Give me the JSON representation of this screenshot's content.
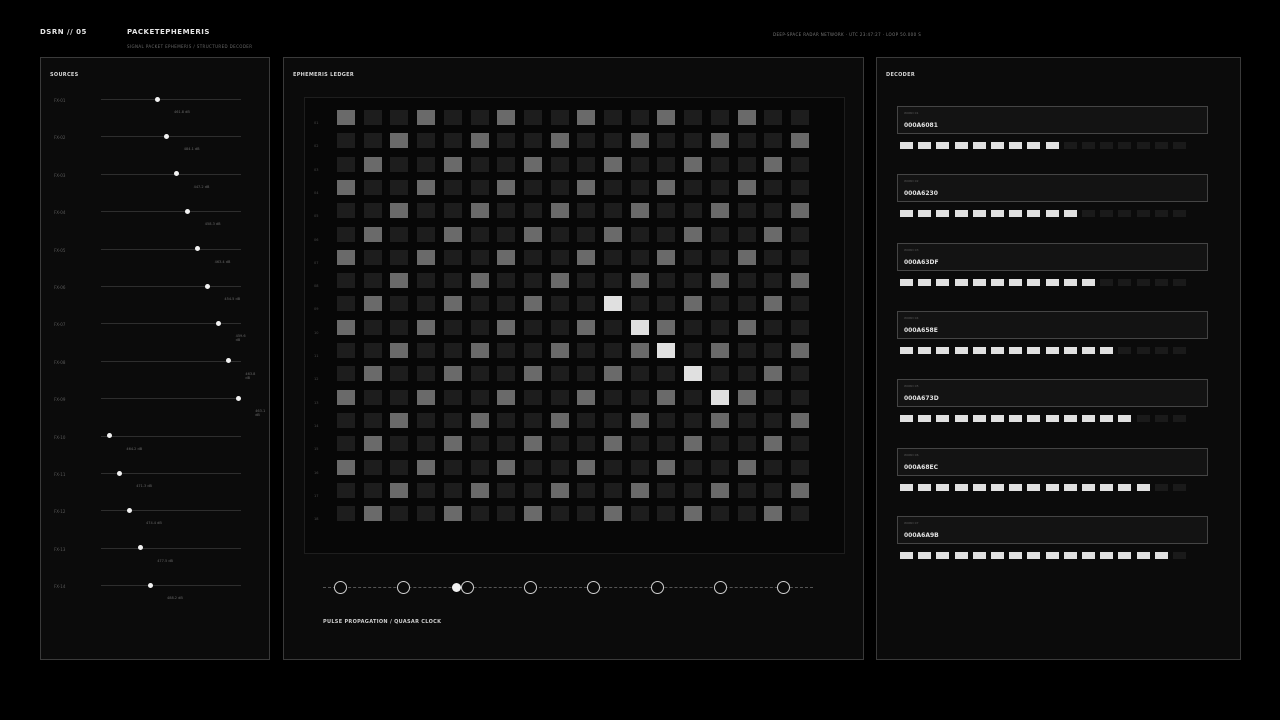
{
  "header": {
    "code": "DSRN // 05",
    "title": "PACKETEPHEMERIS",
    "subtitle": "SIGNAL PACKET EPHEMERIS / STRUCTURED DECODER",
    "status": "DEEP-SPACE RADAR NETWORK · UTC 23:47:27 · LOOP 50.000 S"
  },
  "sources": {
    "title": "SOURCES",
    "items": [
      {
        "label": "FX-01",
        "level": 0.4,
        "value": "461.8 dB"
      },
      {
        "label": "FX-02",
        "level": 0.47,
        "value": "484.1 dB"
      },
      {
        "label": "FX-03",
        "level": 0.54,
        "value": "447.2 dB"
      },
      {
        "label": "FX-04",
        "level": 0.62,
        "value": "458.3 dB"
      },
      {
        "label": "FX-05",
        "level": 0.69,
        "value": "463.4 dB"
      },
      {
        "label": "FX-06",
        "level": 0.76,
        "value": "454.5 dB"
      },
      {
        "label": "FX-07",
        "level": 0.84,
        "value": "459.6 dB"
      },
      {
        "label": "FX-08",
        "level": 0.91,
        "value": "463.8 dB"
      },
      {
        "label": "FX-09",
        "level": 0.98,
        "value": "463.1 dB"
      },
      {
        "label": "FX-10",
        "level": 0.06,
        "value": "464.2 dB"
      },
      {
        "label": "FX-11",
        "level": 0.13,
        "value": "471.3 dB"
      },
      {
        "label": "FX-12",
        "level": 0.2,
        "value": "474.4 dB"
      },
      {
        "label": "FX-13",
        "level": 0.28,
        "value": "477.5 dB"
      },
      {
        "label": "FX-14",
        "level": 0.35,
        "value": "488.2 dB"
      }
    ]
  },
  "ledger": {
    "title": "EPHEMERIS LEDGER",
    "row_labels": [
      "01",
      "02",
      "03",
      "04",
      "05",
      "06",
      "07",
      "08",
      "09",
      "10",
      "11",
      "12",
      "13",
      "14",
      "15",
      "16",
      "17",
      "18"
    ],
    "highlights": [
      [
        8,
        10
      ],
      [
        9,
        11
      ],
      [
        10,
        12
      ],
      [
        11,
        13
      ],
      [
        12,
        14
      ]
    ],
    "timeline_label": "PULSE PROPAGATION / QUASAR CLOCK",
    "timeline_nodes": 8,
    "timeline_active": 2
  },
  "decoder": {
    "title": "DECODER",
    "entries": [
      {
        "tag": "WORD 01",
        "id": "000A6081",
        "filled": 9
      },
      {
        "tag": "WORD 02",
        "id": "000A6230",
        "filled": 10
      },
      {
        "tag": "WORD 03",
        "id": "000A63DF",
        "filled": 11
      },
      {
        "tag": "WORD 04",
        "id": "000A658E",
        "filled": 12
      },
      {
        "tag": "WORD 05",
        "id": "000A673D",
        "filled": 13
      },
      {
        "tag": "WORD 06",
        "id": "000A68EC",
        "filled": 14
      },
      {
        "tag": "WORD 07",
        "id": "000A6A9B",
        "filled": 15
      }
    ],
    "bars_per_entry": 16
  },
  "colors": {
    "on": "#e0e0e0",
    "mid": "#6a6a6a",
    "dim": "#1d1d1d",
    "bar_off": "#1a1a1a"
  }
}
